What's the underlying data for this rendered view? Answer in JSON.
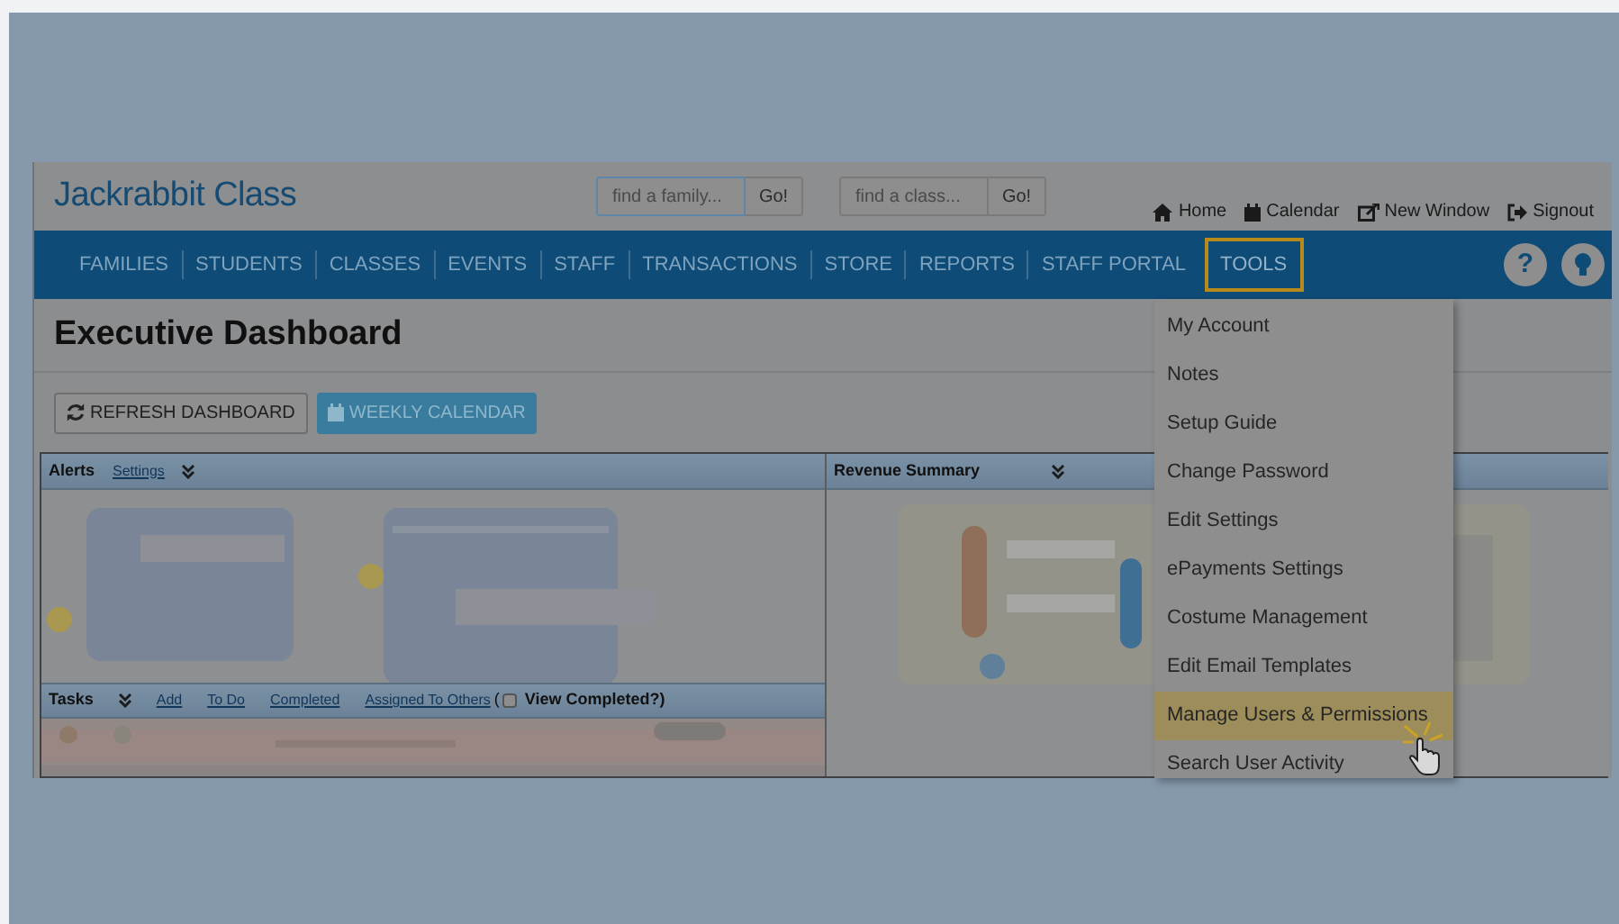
{
  "logo": "Jackrabbit Class",
  "searches": [
    {
      "placeholder": "find a family...",
      "button": "Go!"
    },
    {
      "placeholder": "find a class...",
      "button": "Go!"
    }
  ],
  "top_links": [
    {
      "kind": "home",
      "label": "Home"
    },
    {
      "kind": "calendar",
      "label": "Calendar"
    },
    {
      "kind": "window",
      "label": "New Window"
    },
    {
      "kind": "signout",
      "label": "Signout"
    }
  ],
  "nav": [
    {
      "label": "FAMILIES",
      "selected": false
    },
    {
      "label": "STUDENTS",
      "selected": false
    },
    {
      "label": "CLASSES",
      "selected": false
    },
    {
      "label": "EVENTS",
      "selected": false
    },
    {
      "label": "STAFF",
      "selected": false
    },
    {
      "label": "TRANSACTIONS",
      "selected": false
    },
    {
      "label": "STORE",
      "selected": false
    },
    {
      "label": "REPORTS",
      "selected": false
    },
    {
      "label": "STAFF PORTAL",
      "selected": false
    },
    {
      "label": "TOOLS",
      "selected": true
    }
  ],
  "help_buttons": [
    {
      "kind": "help",
      "label": "?"
    },
    {
      "kind": "tip"
    }
  ],
  "page_title": "Executive Dashboard",
  "actions": [
    {
      "kind": "refresh",
      "label": "REFRESH DASHBOARD"
    },
    {
      "kind": "calendar",
      "label": "WEEKLY CALENDAR"
    }
  ],
  "alerts": {
    "title": "Alerts",
    "links": [
      "Settings"
    ],
    "content": {
      "kind": "picture"
    }
  },
  "revenue": {
    "title": "Revenue Summary",
    "content": {
      "kind": "picture"
    }
  },
  "tasks": {
    "title": "Tasks",
    "links": [
      "Add",
      "To Do",
      "Completed",
      "Assigned To Others"
    ],
    "paren": "(",
    "view_completed": {
      "label": "View Completed?)",
      "checked": false
    }
  },
  "tools_menu": [
    {
      "label": "My Account",
      "selected": false
    },
    {
      "label": "Notes",
      "selected": false
    },
    {
      "label": "Setup Guide",
      "selected": false
    },
    {
      "label": "Change Password",
      "selected": false
    },
    {
      "label": "Edit Settings",
      "selected": false
    },
    {
      "label": "ePayments Settings",
      "selected": false
    },
    {
      "label": "Costume Management",
      "selected": false
    },
    {
      "label": "Edit Email Templates",
      "selected": false
    },
    {
      "label": "Manage Users & Permissions",
      "selected": true
    },
    {
      "label": "Search User Activity",
      "selected": false
    }
  ]
}
